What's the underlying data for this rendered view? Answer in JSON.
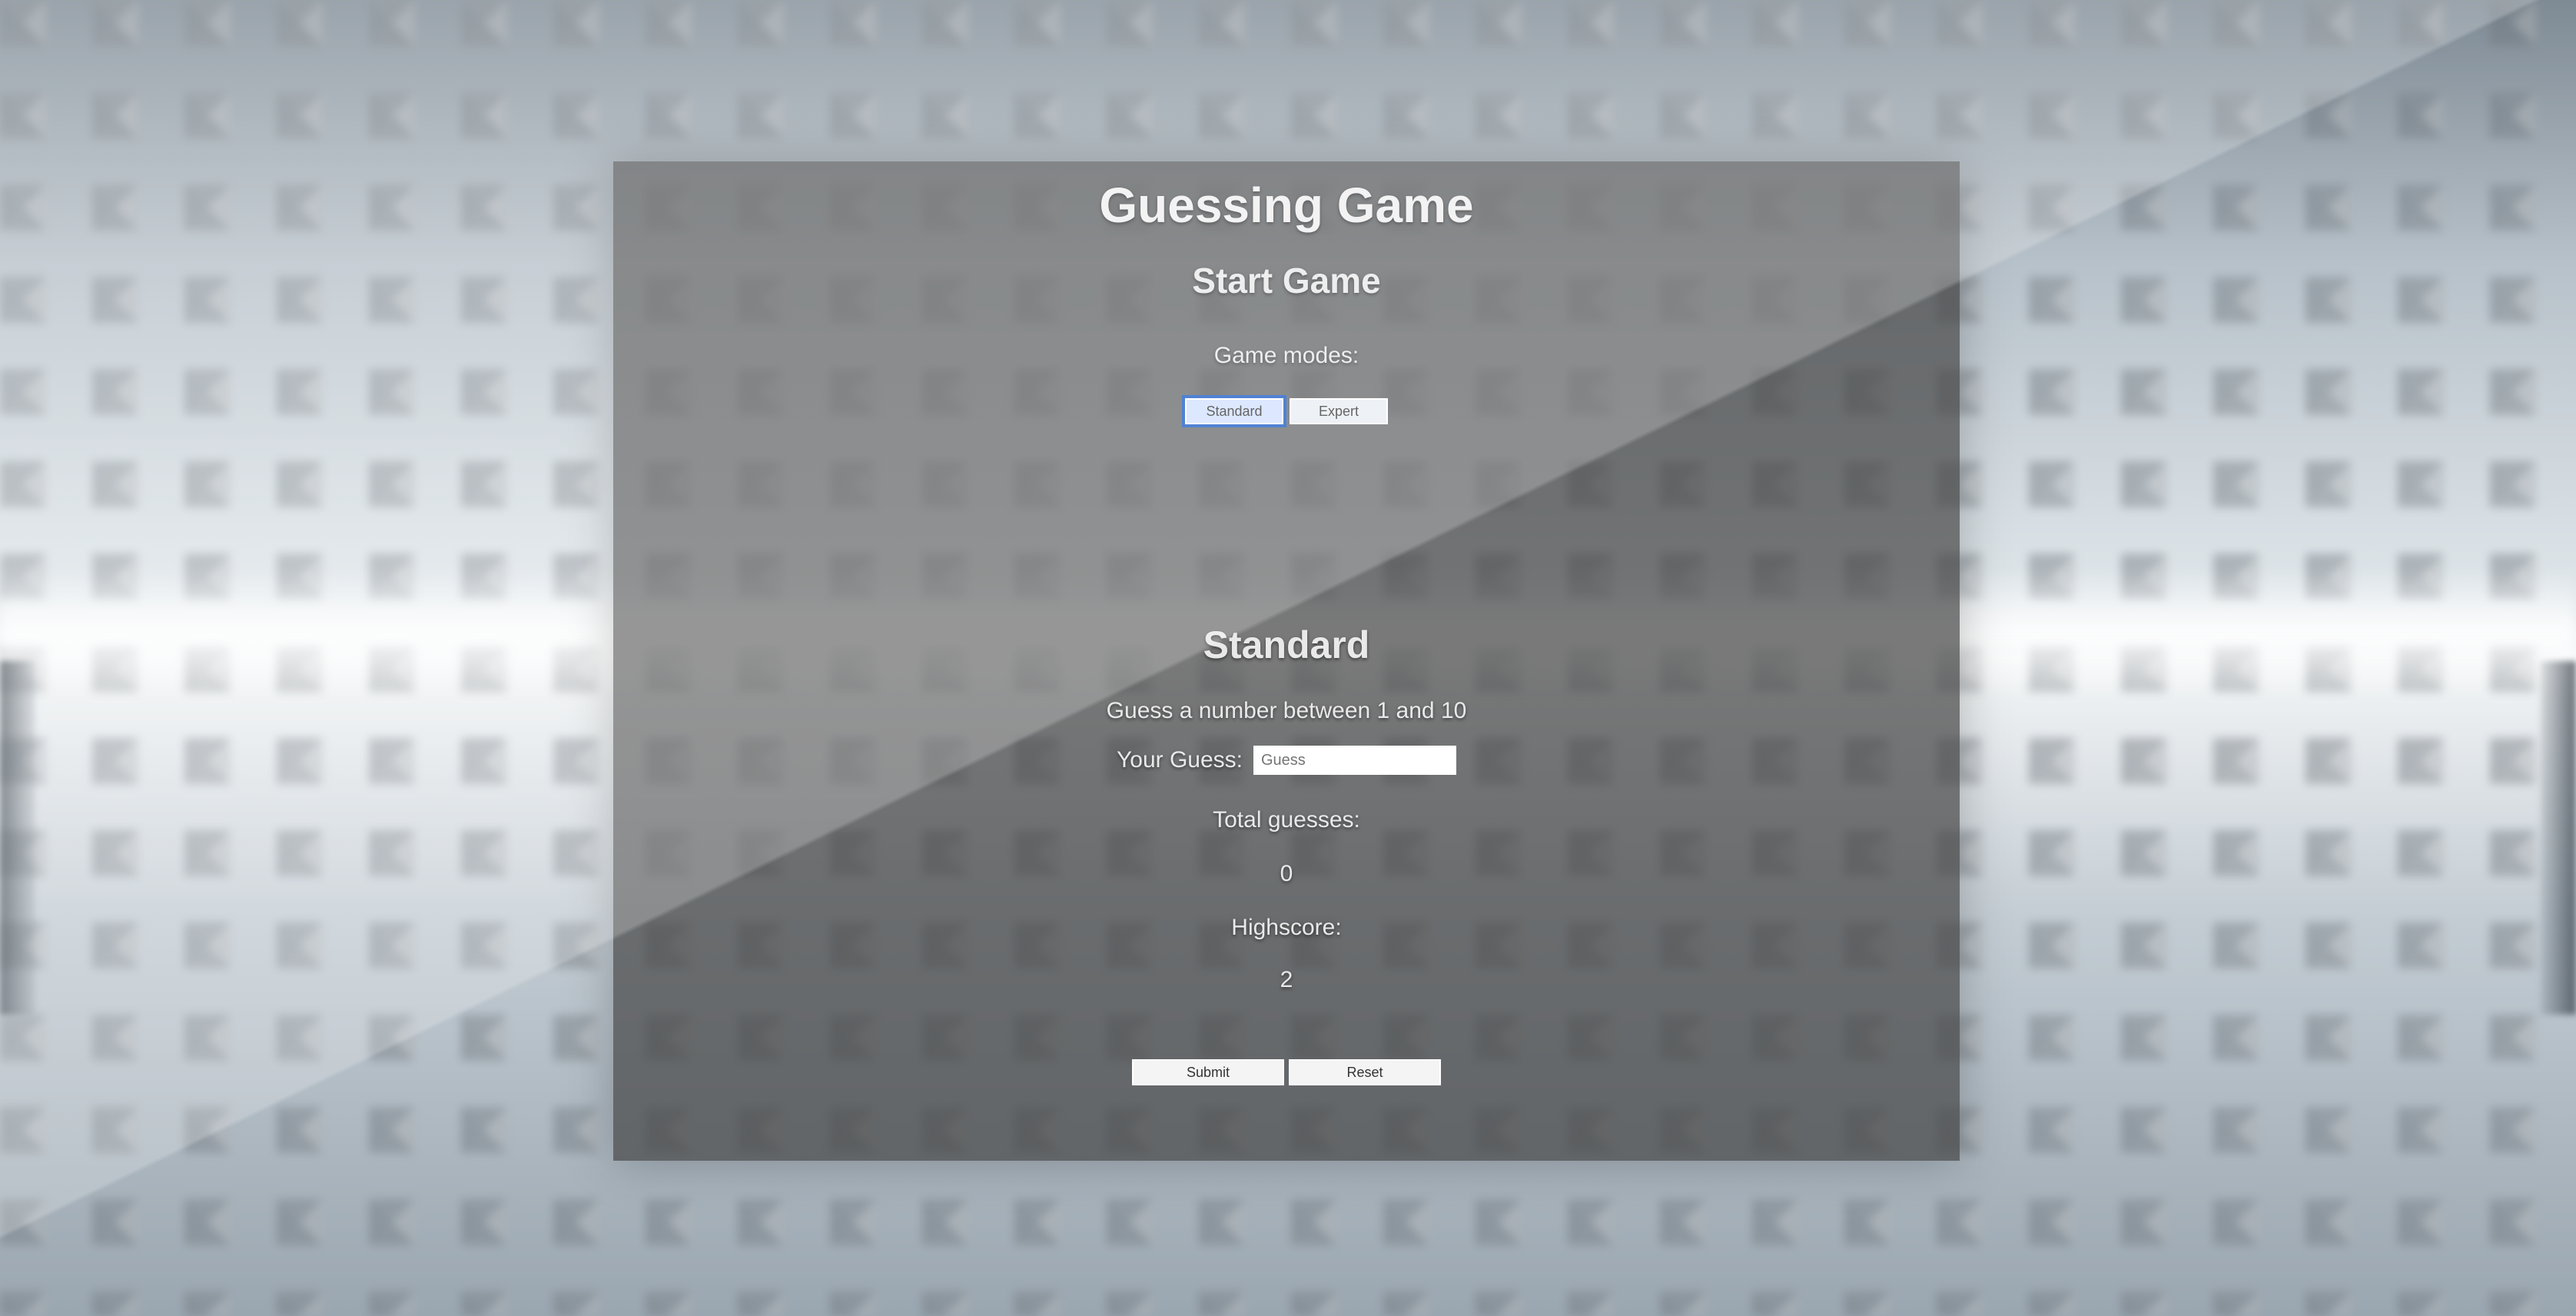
{
  "app": {
    "title": "Guessing Game"
  },
  "start": {
    "heading": "Start Game",
    "modes_label": "Game modes:",
    "modes": [
      {
        "label": "Standard",
        "active": true
      },
      {
        "label": "Expert",
        "active": false
      }
    ]
  },
  "game": {
    "mode_title": "Standard",
    "instruction": "Guess a number between 1 and 10",
    "guess_label": "Your Guess:",
    "guess_placeholder": "Guess",
    "guess_value": "",
    "total_label": "Total guesses:",
    "total_value": "0",
    "highscore_label": "Highscore:",
    "highscore_value": "2",
    "submit_label": "Submit",
    "reset_label": "Reset"
  },
  "colors": {
    "panel": "#464646",
    "active_outline": "#1f5fc8",
    "text": "#e9e9e9"
  }
}
